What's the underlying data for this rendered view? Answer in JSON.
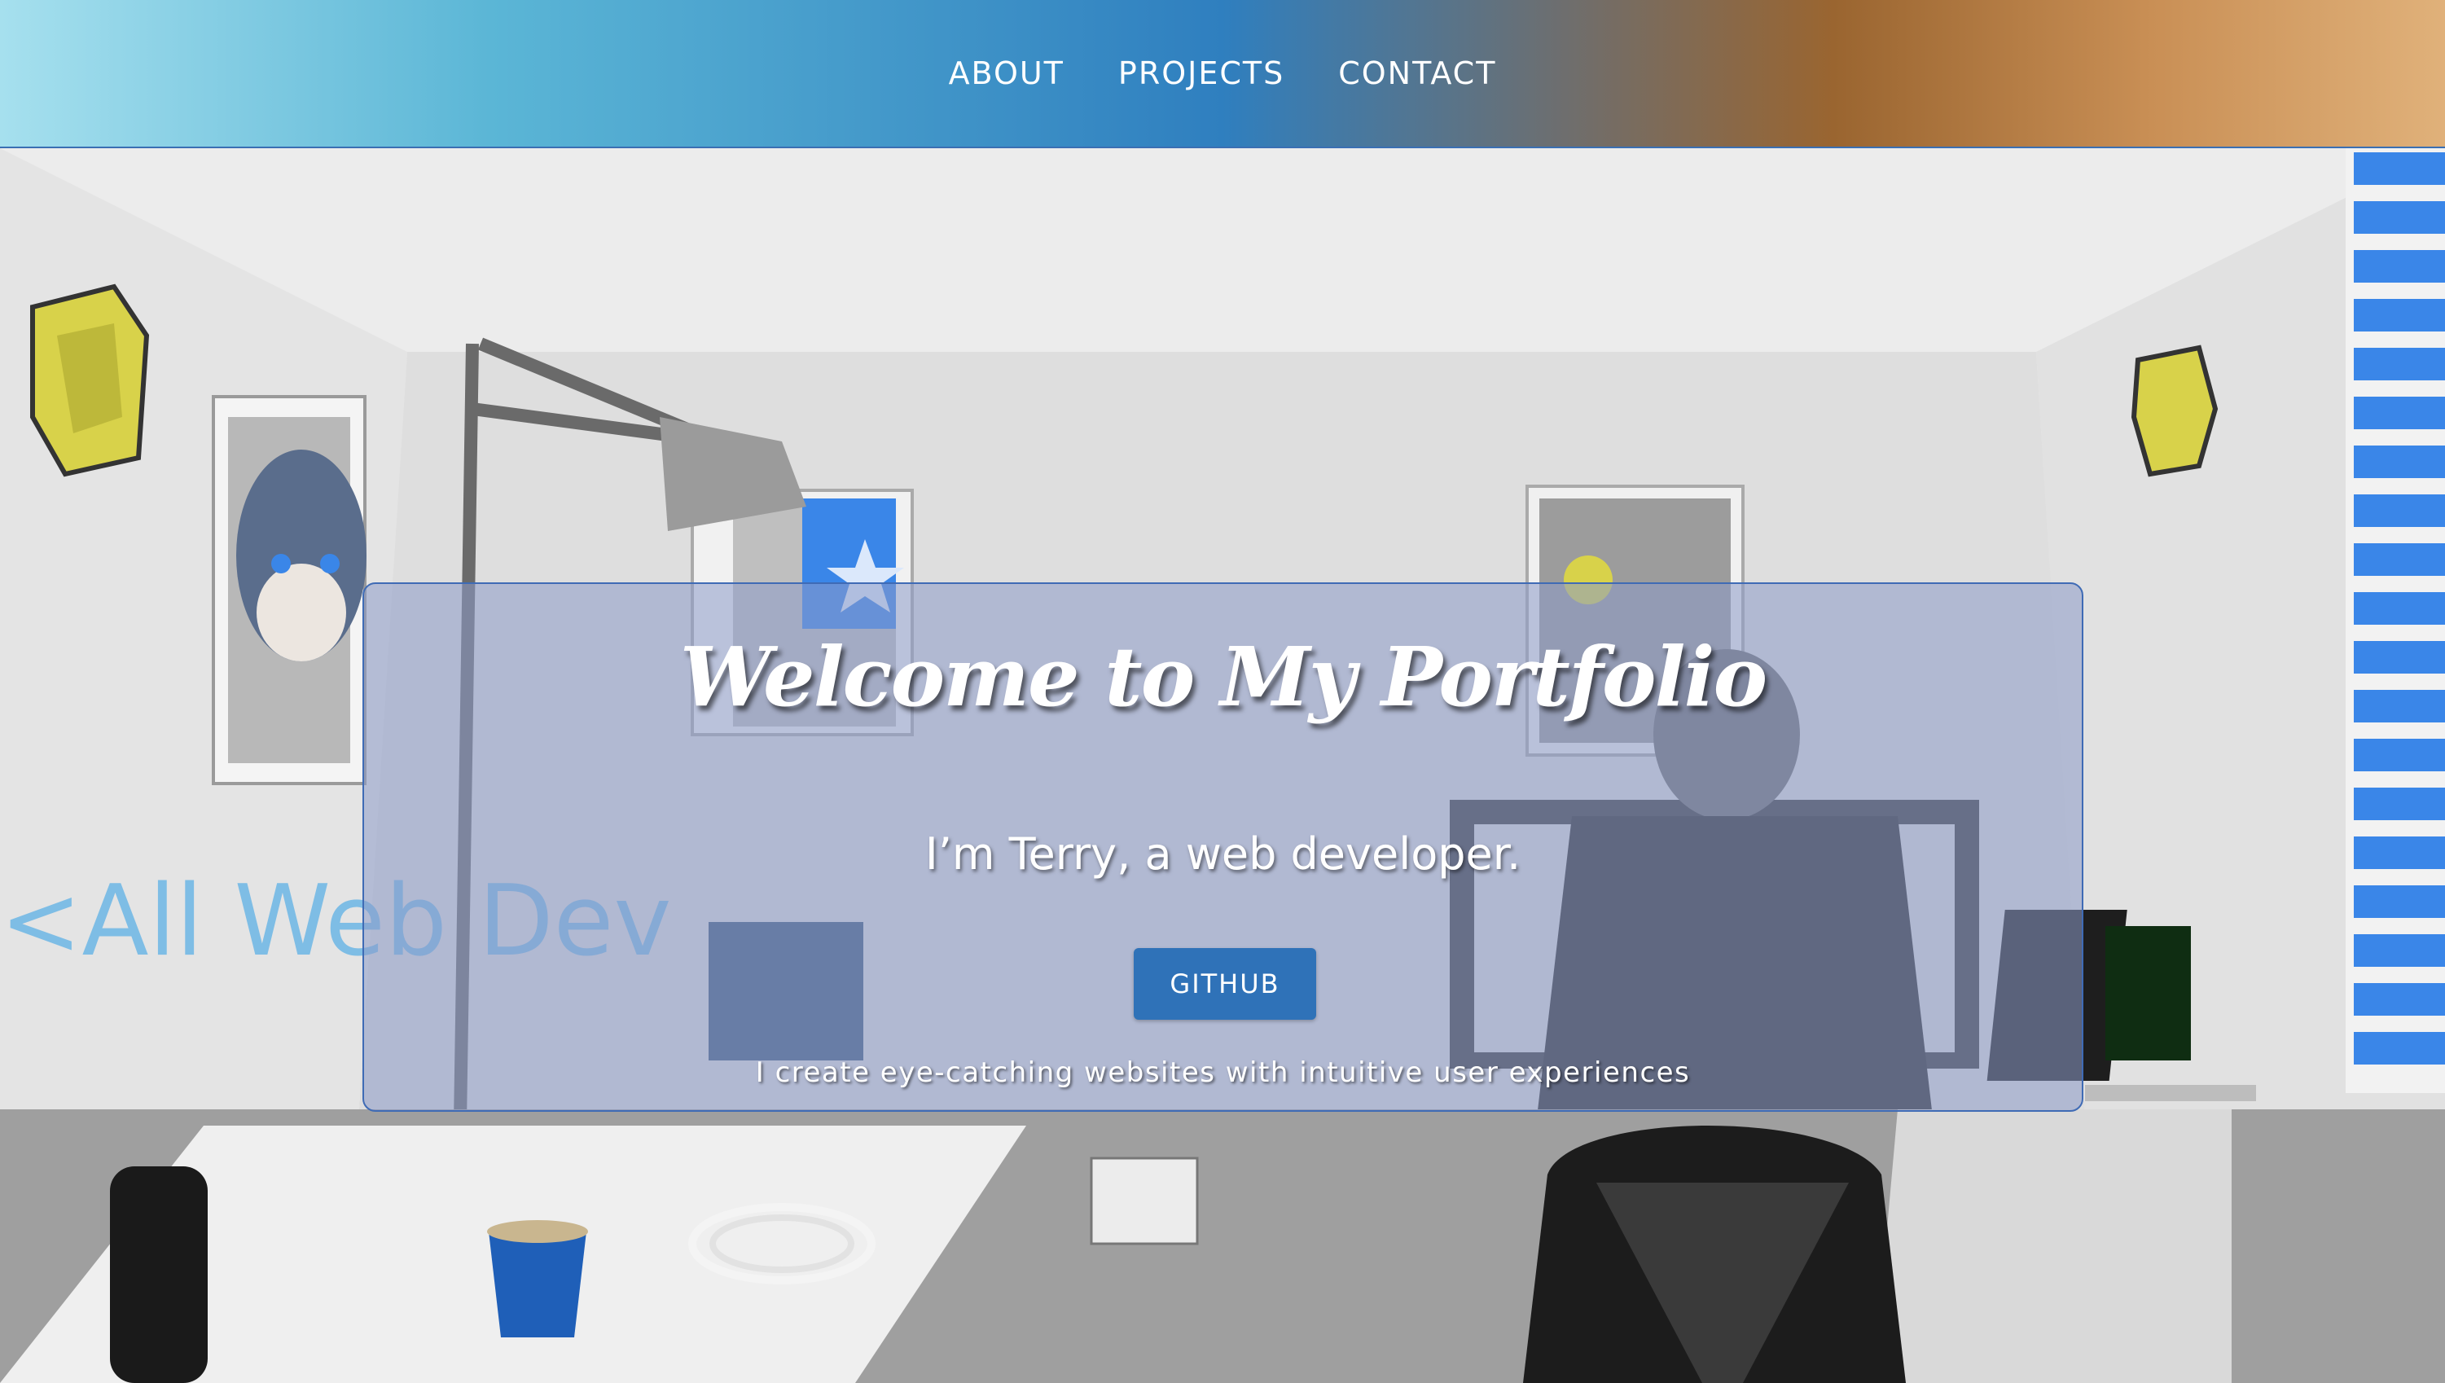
{
  "nav": {
    "items": [
      {
        "label": "ABOUT"
      },
      {
        "label": "PROJECTS"
      },
      {
        "label": "CONTACT"
      }
    ]
  },
  "hero": {
    "wall_text": "<All Web Dev",
    "title": "Welcome to My Portfolio",
    "subtitle": "I’m Terry, a web developer.",
    "button_label": "GITHUB",
    "tagline": "I create eye-catching websites with intuitive user experiences"
  },
  "colors": {
    "nav_gradient_start": "#a6e0ee",
    "nav_gradient_mid": "#2f7fbf",
    "nav_gradient_end": "#e0b17a",
    "button": "#2f72b8",
    "card_border": "#3f6bb5",
    "accent_blue": "#3a86e8",
    "lamp_yellow": "#d8d24a"
  }
}
